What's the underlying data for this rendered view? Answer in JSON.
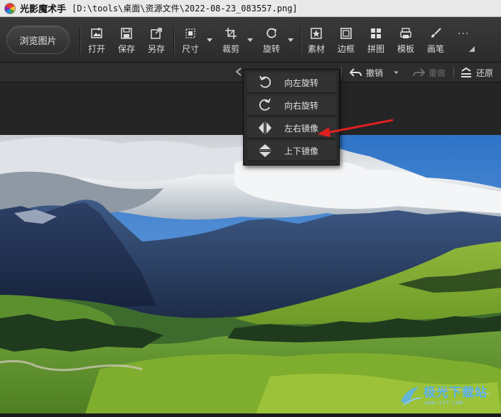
{
  "titlebar": {
    "app_name": "光影魔术手",
    "file_path": "[D:\\tools\\桌面\\资源文件\\2022-08-23_083557.png]"
  },
  "toolbar": {
    "browse_label": "浏览图片",
    "tools": [
      {
        "label": "打开",
        "icon": "open-image-icon"
      },
      {
        "label": "保存",
        "icon": "save-icon"
      },
      {
        "label": "另存",
        "icon": "save-as-icon"
      },
      {
        "label": "尺寸",
        "icon": "resize-icon"
      },
      {
        "label": "裁剪",
        "icon": "crop-icon"
      },
      {
        "label": "旋转",
        "icon": "rotate-icon"
      },
      {
        "label": "素材",
        "icon": "material-icon"
      },
      {
        "label": "边框",
        "icon": "border-icon"
      },
      {
        "label": "拼图",
        "icon": "collage-icon"
      },
      {
        "label": "模板",
        "icon": "template-icon"
      },
      {
        "label": "画笔",
        "icon": "brush-icon"
      }
    ],
    "more_label": "···"
  },
  "subbar": {
    "undo_label": "撤销",
    "redo_label": "重做",
    "restore_label": "还原"
  },
  "rotate_menu": {
    "items": [
      {
        "label": "向左旋转",
        "icon": "rotate-left-icon"
      },
      {
        "label": "向右旋转",
        "icon": "rotate-right-icon"
      },
      {
        "label": "左右镜像",
        "icon": "flip-horizontal-icon"
      },
      {
        "label": "上下镜像",
        "icon": "flip-vertical-icon"
      }
    ]
  },
  "annotation": {
    "color": "#e02020"
  },
  "watermark": {
    "text": "极光下载站",
    "sub": "www.xz7.com"
  },
  "colors": {
    "toolbar_bg": "#333333",
    "menu_bg": "#2a2a2a",
    "accent": "#5ab1ee"
  }
}
